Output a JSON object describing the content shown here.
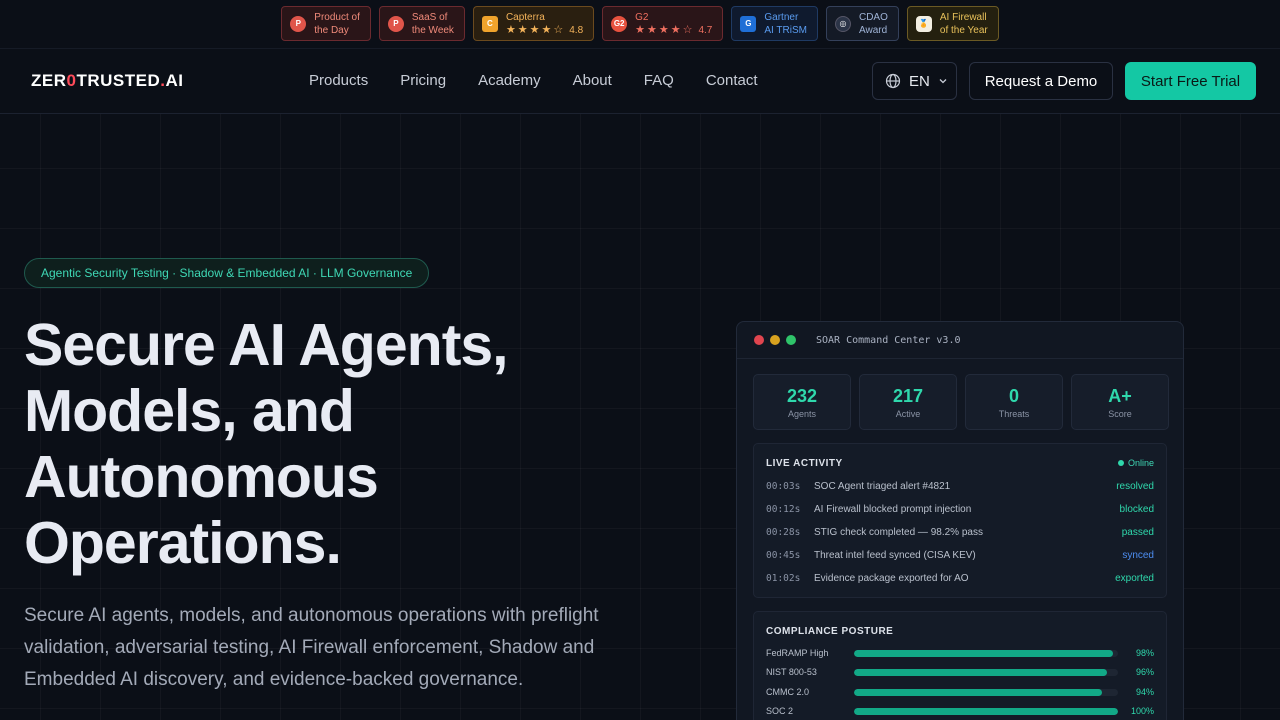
{
  "badges": [
    {
      "line1": "Product of",
      "line2": "the Day",
      "icon": "P"
    },
    {
      "line1": "SaaS of",
      "line2": "the Week",
      "icon": "P"
    },
    {
      "line1": "Capterra",
      "stars": "★★★★☆",
      "rating": "4.8",
      "icon": "C"
    },
    {
      "line1": "G2",
      "stars": "★★★★☆",
      "rating": "4.7",
      "icon": "G2"
    },
    {
      "line1": "Gartner",
      "line2": "AI TRiSM",
      "icon": "G"
    },
    {
      "line1": "CDAO",
      "line2": "Award",
      "icon": "◎"
    },
    {
      "line1": "AI Firewall",
      "line2": "of the Year",
      "icon": "🏅"
    }
  ],
  "nav": {
    "logo_a": "ZER",
    "logo_b": "0",
    "logo_c": "TRUSTED",
    "logo_d": ".",
    "logo_e": "AI",
    "links": [
      "Products",
      "Pricing",
      "Academy",
      "About",
      "FAQ",
      "Contact"
    ],
    "lang": "EN",
    "demo": "Request a Demo",
    "trial": "Start Free Trial"
  },
  "hero": {
    "pill": "Agentic Security Testing · Shadow & Embedded AI · LLM Governance",
    "headline_1": "Secure AI Agents,",
    "headline_2": "Models, and",
    "headline_3": "Autonomous",
    "headline_4": "Operations.",
    "subtext": "Secure AI agents, models, and autonomous operations with preflight validation, adversarial testing, AI Firewall enforcement, Shadow and Embedded AI discovery, and evidence-backed governance."
  },
  "dashboard": {
    "title": "SOAR Command Center v3.0",
    "stats": [
      {
        "value": "232",
        "label": "Agents"
      },
      {
        "value": "217",
        "label": "Active"
      },
      {
        "value": "0",
        "label": "Threats"
      },
      {
        "value": "A+",
        "label": "Score"
      }
    ],
    "activity_title": "LIVE ACTIVITY",
    "online": "Online",
    "activity": [
      {
        "time": "00:03s",
        "desc": "SOC Agent triaged alert #4821",
        "status": "resolved"
      },
      {
        "time": "00:12s",
        "desc": "AI Firewall blocked prompt injection",
        "status": "blocked"
      },
      {
        "time": "00:28s",
        "desc": "STIG check completed — 98.2% pass",
        "status": "passed"
      },
      {
        "time": "00:45s",
        "desc": "Threat intel feed synced (CISA KEV)",
        "status": "synced"
      },
      {
        "time": "01:02s",
        "desc": "Evidence package exported for AO",
        "status": "exported"
      }
    ],
    "compliance_title": "COMPLIANCE POSTURE",
    "compliance": [
      {
        "name": "FedRAMP High",
        "pct_label": "98%",
        "pct": 98
      },
      {
        "name": "NIST 800-53",
        "pct_label": "96%",
        "pct": 96
      },
      {
        "name": "CMMC 2.0",
        "pct_label": "94%",
        "pct": 94
      },
      {
        "name": "SOC 2",
        "pct_label": "100%",
        "pct": 100
      }
    ]
  },
  "colors": {
    "accent": "#14c8a4",
    "background": "#0b0f17",
    "logo_zero": "#ff4b5a"
  }
}
